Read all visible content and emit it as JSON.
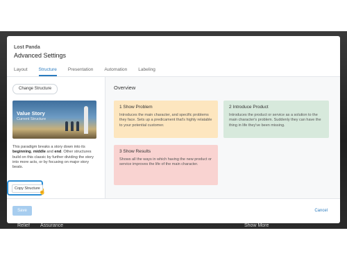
{
  "background": {
    "labels": [
      "Relief",
      "Assurance"
    ],
    "right_label": "Show More"
  },
  "modal": {
    "subtitle": "Lost Panda",
    "title": "Advanced Settings",
    "tabs": [
      {
        "label": "Layout",
        "active": false
      },
      {
        "label": "Structure",
        "active": true
      },
      {
        "label": "Presentation",
        "active": false
      },
      {
        "label": "Automation",
        "active": false
      },
      {
        "label": "Labeling",
        "active": false
      }
    ]
  },
  "left": {
    "change_button": "Change Structure",
    "story": {
      "title": "Value Story",
      "subtitle": "Current Structure"
    },
    "description": {
      "p1": "This paradigm breaks a story down into its ",
      "b1": "beginning",
      "p2": ", ",
      "b2": "middle",
      "p3": " and ",
      "b3": "end",
      "p4": ". Other structures build on this classic by further dividing the story into more acts, or by focusing on major story beats."
    },
    "copy_button": "Copy Structure"
  },
  "right": {
    "heading": "Overview",
    "cards": [
      {
        "title": "1   Show Problem",
        "text": "Introduces the main character, and specific problems they face. Sets up a predicament that's highly relatable to your potential customer.",
        "color": "#fde6bf"
      },
      {
        "title": "2   Introduce Product",
        "text": "Introduces the product or service as a solution to the main character's problem. Suddenly they can have the thing in life they've been missing.",
        "color": "#d7e9dc"
      },
      {
        "title": "3   Show Results",
        "text": "Shows all the ways in which having the new product or service improves the life of the main character.",
        "color": "#f9d3d1"
      }
    ]
  },
  "footer": {
    "save": "Save",
    "cancel": "Cancel"
  }
}
